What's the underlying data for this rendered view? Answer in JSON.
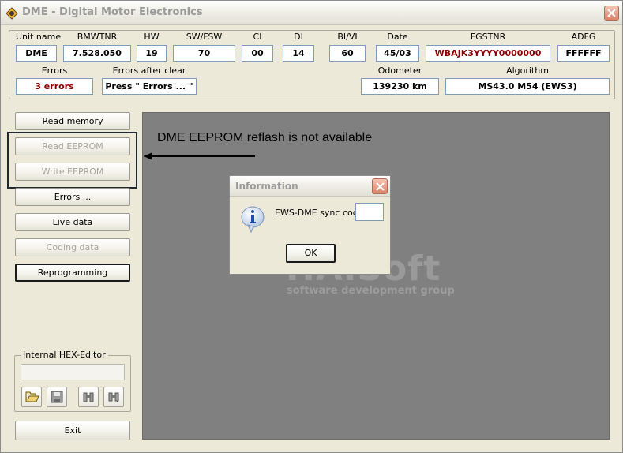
{
  "window": {
    "title": "DME - Digital Motor Electronics"
  },
  "header": {
    "labels": {
      "unit_name": "Unit name",
      "bmwtnr": "BMWTNR",
      "hw": "HW",
      "sw_fsw": "SW/FSW",
      "ci": "CI",
      "di": "DI",
      "bi_vi": "BI/VI",
      "date": "Date",
      "fgstnr": "FGSTNR",
      "adfg": "ADFG",
      "errors": "Errors",
      "errors_after_clear": "Errors after clear",
      "odometer": "Odometer",
      "algorithm": "Algorithm"
    },
    "values": {
      "unit_name": "DME",
      "bmwtnr": "7.528.050",
      "hw": "19",
      "sw_fsw": "70",
      "ci": "00",
      "di": "14",
      "bi_vi": "60",
      "date": "45/03",
      "fgstnr": "WBAJK3YYYY0000000",
      "adfg": "FFFFFF",
      "errors": "3 errors",
      "errors_after_clear": "Press \" Errors ... \"",
      "odometer": "139230 km",
      "algorithm": "MS43.0 M54 (EWS3)"
    }
  },
  "buttons": {
    "read_memory": "Read memory",
    "read_eeprom": "Read EEPROM",
    "write_eeprom": "Write EEPROM",
    "errors": "Errors ...",
    "live_data": "Live data",
    "coding_data": "Coding data",
    "reprogramming": "Reprogramming",
    "exit": "Exit"
  },
  "hex_editor": {
    "label": "Internal HEX-Editor",
    "value": ""
  },
  "annotation": {
    "text": "DME EEPROM reflash is not available"
  },
  "watermark": {
    "big": "HAISoft",
    "small": "software development group"
  },
  "dialog": {
    "title": "Information",
    "prompt": "EWS-DME sync code:",
    "input_value": "",
    "ok_label": "OK"
  },
  "colors": {
    "error_text": "#8b0000",
    "background": "#ece9d8",
    "main_area": "#808080"
  },
  "icons": [
    "app-icon",
    "close-icon",
    "info-icon",
    "open-folder-icon",
    "save-icon",
    "binoculars-icon",
    "binoculars-next-icon"
  ]
}
